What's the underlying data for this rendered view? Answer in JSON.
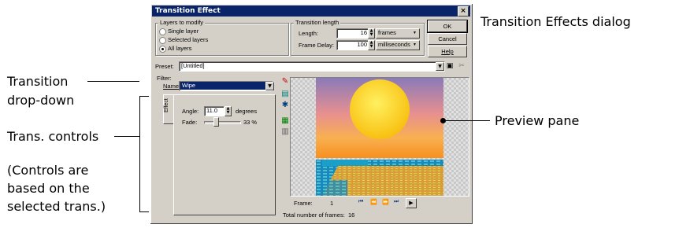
{
  "callouts": {
    "dialog_title": "Transition Effects dialog",
    "transition_dropdown_line1": "Transition",
    "transition_dropdown_line2": "drop-down",
    "trans_controls": "Trans. controls",
    "note_line1": "(Controls are",
    "note_line2": "based on the",
    "note_line3": "selected trans.)",
    "preview_pane": "Preview pane"
  },
  "dialog": {
    "title": "Transition Effect",
    "close": "×",
    "layers_group": {
      "label": "Layers to modify",
      "options": [
        "Single layer",
        "Selected layers",
        "All layers"
      ],
      "selected": "All layers"
    },
    "length_group": {
      "label": "Transition length",
      "length_label": "Length:",
      "length_value": "16",
      "length_unit": "frames",
      "delay_label": "Frame Delay:",
      "delay_value": "100",
      "delay_unit": "milliseconds"
    },
    "buttons": {
      "ok": "OK",
      "cancel": "Cancel",
      "help": "Help"
    },
    "preset": {
      "label": "Preset:",
      "value": "[Untitled]"
    },
    "filter": {
      "label": "Filter:",
      "name_label": "Name:",
      "name_value": "Wipe"
    },
    "effect_tab": "Effect",
    "angle": {
      "label": "Angle:",
      "value": "11.0",
      "unit": "degrees"
    },
    "fade": {
      "label": "Fade:",
      "value": "33 %",
      "fraction": 0.33
    },
    "frame": {
      "label": "Frame:",
      "value": "1",
      "total_label": "Total number of frames:",
      "total_value": "16"
    }
  },
  "icons": {
    "save": "save-icon",
    "delete": "delete-icon",
    "playback": [
      "first-frame-icon",
      "prev-frame-icon",
      "next-frame-icon",
      "last-frame-icon",
      "play-icon"
    ]
  }
}
